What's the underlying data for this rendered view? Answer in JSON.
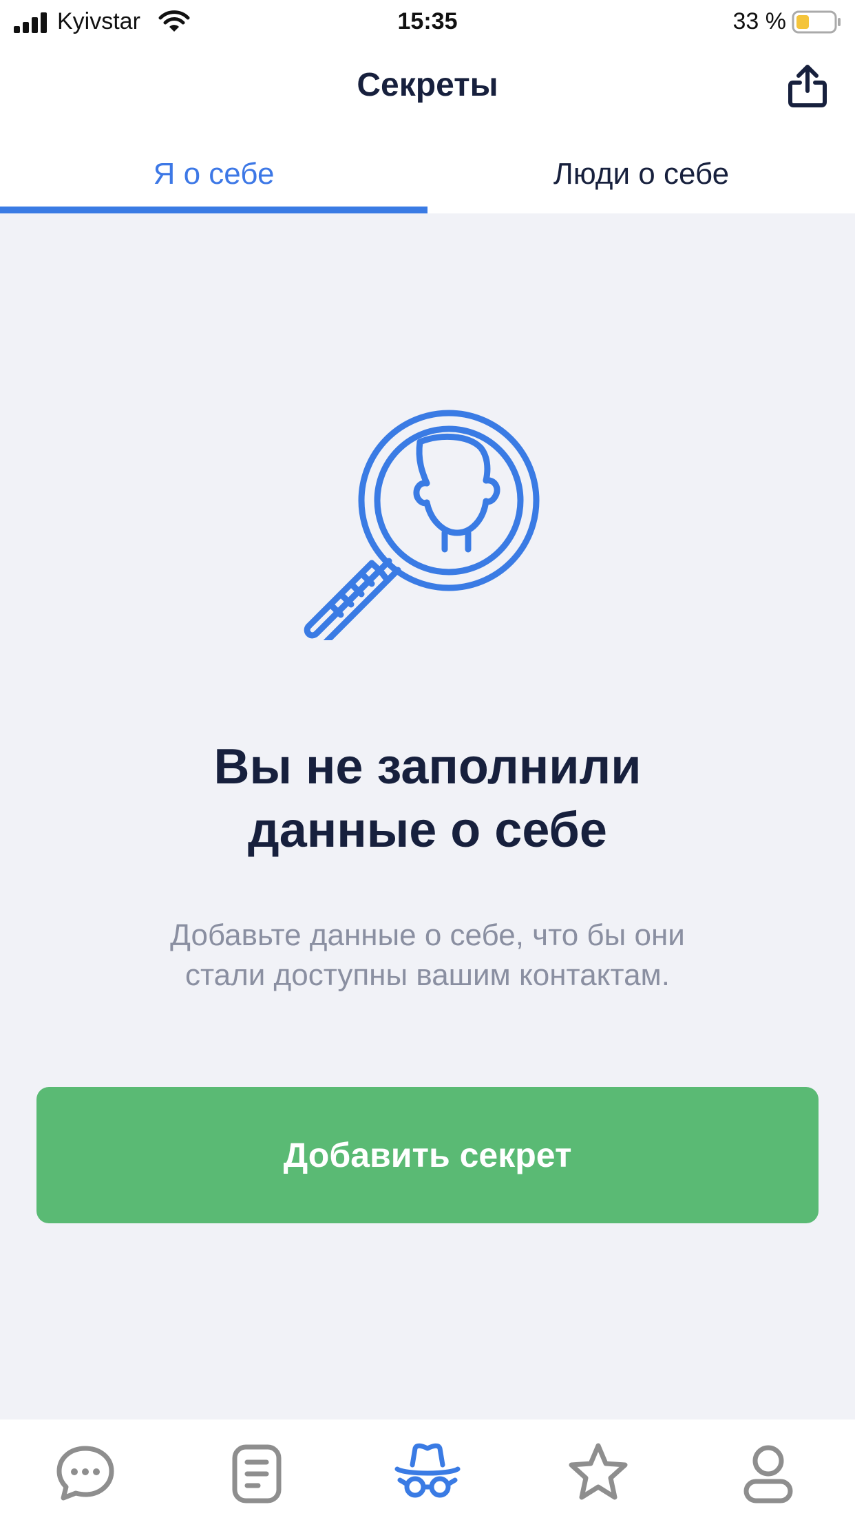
{
  "status_bar": {
    "carrier": "Kyivstar",
    "time": "15:35",
    "battery_text": "33 %",
    "icons": [
      "signal-icon",
      "wifi-icon",
      "battery-icon"
    ]
  },
  "header": {
    "title": "Секреты",
    "share_icon": "share-icon"
  },
  "tabs": [
    {
      "label": "Я о себе",
      "active": true
    },
    {
      "label": "Люди о себе",
      "active": false
    }
  ],
  "empty_state": {
    "illustration_icon": "magnifier-person-icon",
    "headline_line1": "Вы не заполнили",
    "headline_line2": "данные о себе",
    "description_line1": "Добавьте данные о себе, что бы они",
    "description_line2": "стали доступны вашим контактам.",
    "button_label": "Добавить секрет"
  },
  "tab_bar": {
    "items": [
      {
        "icon": "chat-icon",
        "active": false
      },
      {
        "icon": "notes-icon",
        "active": false
      },
      {
        "icon": "secrets-spy-icon",
        "active": true
      },
      {
        "icon": "star-icon",
        "active": false
      },
      {
        "icon": "profile-icon",
        "active": false
      }
    ]
  },
  "colors": {
    "accent_blue": "#3a7be4",
    "button_green": "#5aba74",
    "background": "#f1f2f7",
    "text_dark": "#17203d",
    "text_muted": "#8a8fa1",
    "icon_gray": "#8e8e8e",
    "battery_yellow": "#f4c43b"
  }
}
